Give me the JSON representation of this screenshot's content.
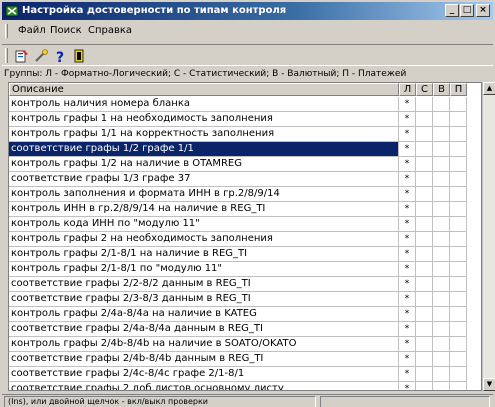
{
  "window": {
    "title": "Настройка достоверности по типам контроля",
    "minimize_label": "_",
    "restore_label": "□",
    "close_label": "×"
  },
  "menu": [
    "Файл",
    "Поиск",
    "Справка"
  ],
  "toolbar": {
    "tools": [
      {
        "name": "run-icon"
      },
      {
        "name": "search-icon"
      },
      {
        "name": "help-icon"
      },
      {
        "name": "exit-icon"
      }
    ],
    "help_glyph": "?"
  },
  "groups_text": "Группы: Л - Форматно-Логический; С - Статистический; В - Валютный; П - Платежей",
  "table": {
    "columns": [
      "Описание",
      "Л",
      "С",
      "В",
      "П"
    ],
    "selected_row": 3,
    "rows": [
      {
        "desc": "контроль наличия номера бланка",
        "l": "*",
        "s": "",
        "v": "",
        "p": ""
      },
      {
        "desc": "контроль графы 1 на необходимость заполнения",
        "l": "*",
        "s": "",
        "v": "",
        "p": ""
      },
      {
        "desc": "контроль графы 1/1 на корректность заполнения",
        "l": "*",
        "s": "",
        "v": "",
        "p": ""
      },
      {
        "desc": "соответствие графы 1/2 графе 1/1",
        "l": "*",
        "s": "",
        "v": "",
        "p": ""
      },
      {
        "desc": "контроль графы 1/2 на наличие в OTAMREG",
        "l": "*",
        "s": "",
        "v": "",
        "p": ""
      },
      {
        "desc": "соответствие графы 1/3 графе 37",
        "l": "*",
        "s": "",
        "v": "",
        "p": ""
      },
      {
        "desc": "контроль заполнения и формата ИНН в гр.2/8/9/14",
        "l": "*",
        "s": "",
        "v": "",
        "p": ""
      },
      {
        "desc": "контроль ИНН в гр.2/8/9/14 на наличие в REG_TI",
        "l": "*",
        "s": "",
        "v": "",
        "p": ""
      },
      {
        "desc": "контроль кода ИНН по \"модулю 11\"",
        "l": "*",
        "s": "",
        "v": "",
        "p": ""
      },
      {
        "desc": "контроль графы 2 на необходимость заполнения",
        "l": "*",
        "s": "",
        "v": "",
        "p": ""
      },
      {
        "desc": "контроль графы 2/1-8/1 на наличие в REG_TI",
        "l": "*",
        "s": "",
        "v": "",
        "p": ""
      },
      {
        "desc": "контроль графы 2/1-8/1 по \"модулю 11\"",
        "l": "*",
        "s": "",
        "v": "",
        "p": ""
      },
      {
        "desc": "соответствие графы 2/2-8/2 данным в REG_TI",
        "l": "*",
        "s": "",
        "v": "",
        "p": ""
      },
      {
        "desc": "соответствие графы 2/3-8/3 данным в REG_TI",
        "l": "*",
        "s": "",
        "v": "",
        "p": ""
      },
      {
        "desc": "контроль графы 2/4а-8/4а на наличие в KATEG",
        "l": "*",
        "s": "",
        "v": "",
        "p": ""
      },
      {
        "desc": "соответствие графы 2/4а-8/4а данным в REG_TI",
        "l": "*",
        "s": "",
        "v": "",
        "p": ""
      },
      {
        "desc": "контроль графы 2/4b-8/4b на наличие в SOATO/OKATO",
        "l": "*",
        "s": "",
        "v": "",
        "p": ""
      },
      {
        "desc": "соответствие графы 2/4b-8/4b данным в REG_TI",
        "l": "*",
        "s": "",
        "v": "",
        "p": ""
      },
      {
        "desc": "соответствие графы 2/4с-8/4с графе 2/1-8/1",
        "l": "*",
        "s": "",
        "v": "",
        "p": ""
      },
      {
        "desc": "соответствие графы 2 доб.листов основному листу",
        "l": "*",
        "s": "",
        "v": "",
        "p": ""
      }
    ]
  },
  "status": {
    "left": "(Ins), или двойной щелчок - вкл/выкл проверки",
    "right": ""
  }
}
